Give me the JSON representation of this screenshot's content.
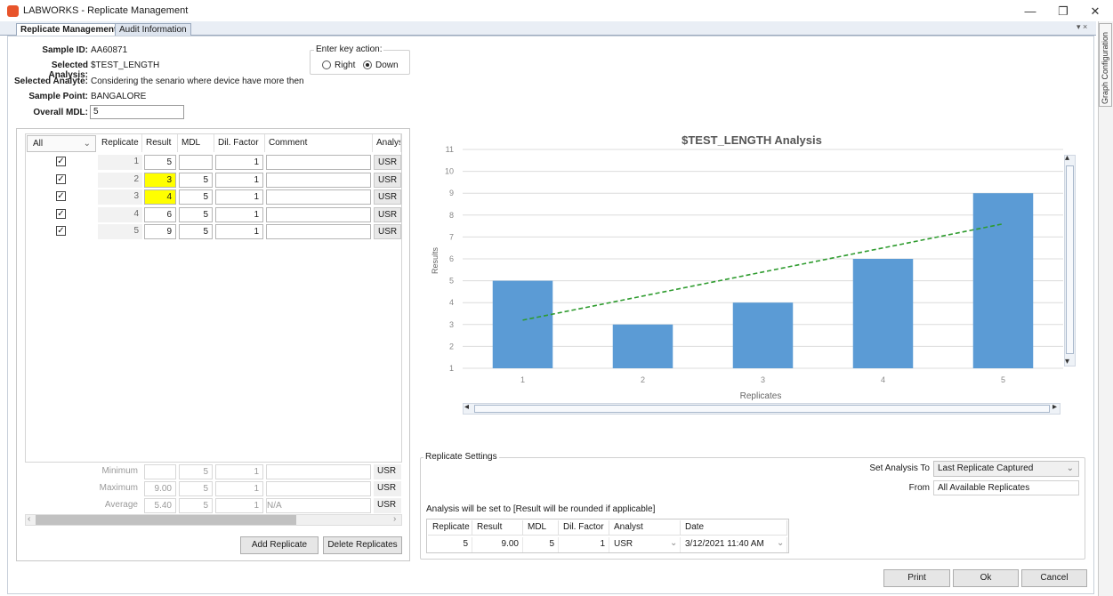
{
  "window": {
    "title": "LABWORKS - Replicate Management",
    "minimize": "—",
    "restore": "❐",
    "close": "✕"
  },
  "tabs": [
    {
      "label": "Replicate Management"
    },
    {
      "label": "Audit Information"
    }
  ],
  "tab_controls": {
    "pin": "▾ ×"
  },
  "side_panel": {
    "label": "Graph Configuration"
  },
  "sample": {
    "sample_id_label": "Sample ID:",
    "sample_id": "AA60871",
    "analysis_label": "Selected Analysis:",
    "analysis": "$TEST_LENGTH",
    "analyte_label": "Selected Analyte:",
    "analyte": "Considering the senario where device have more then",
    "point_label": "Sample Point:",
    "point": "BANGALORE",
    "mdl_label": "Overall MDL:",
    "mdl": "5"
  },
  "enter_key": {
    "title": "Enter key action:",
    "right": "Right",
    "down": "Down",
    "selected": "Down"
  },
  "grid": {
    "filter": "All",
    "columns": [
      "Replicate",
      "Result",
      "MDL",
      "Dil. Factor",
      "Comment",
      "Analys"
    ],
    "rows": [
      {
        "replicate": "1",
        "result": "5",
        "mdl": "",
        "dil": "1",
        "comment": "",
        "analyst": "USR",
        "highlight": false
      },
      {
        "replicate": "2",
        "result": "3",
        "mdl": "5",
        "dil": "1",
        "comment": "",
        "analyst": "USR",
        "highlight": true
      },
      {
        "replicate": "3",
        "result": "4",
        "mdl": "5",
        "dil": "1",
        "comment": "",
        "analyst": "USR",
        "highlight": true
      },
      {
        "replicate": "4",
        "result": "6",
        "mdl": "5",
        "dil": "1",
        "comment": "",
        "analyst": "USR",
        "highlight": false
      },
      {
        "replicate": "5",
        "result": "9",
        "mdl": "5",
        "dil": "1",
        "comment": "",
        "analyst": "USR",
        "highlight": false
      }
    ],
    "summary": [
      {
        "label": "Minimum",
        "result": "",
        "mdl": "5",
        "dil": "1",
        "comment": "",
        "analyst": "USR"
      },
      {
        "label": "Maximum",
        "result": "9.00",
        "mdl": "5",
        "dil": "1",
        "comment": "",
        "analyst": "USR"
      },
      {
        "label": "Average",
        "result": "5.40",
        "mdl": "5",
        "dil": "1",
        "comment": "N/A",
        "analyst": "USR"
      }
    ],
    "check_mark": "✓",
    "add_button": "Add Replicate",
    "delete_button": "Delete Replicates"
  },
  "chart_data": {
    "type": "bar",
    "title": "$TEST_LENGTH Analysis",
    "xlabel": "Replicates",
    "ylabel": "Results",
    "categories": [
      "1",
      "2",
      "3",
      "4",
      "5"
    ],
    "values": [
      5,
      3,
      4,
      6,
      9
    ],
    "ylim": [
      1,
      11
    ],
    "yticks": [
      "1",
      "2",
      "3",
      "4",
      "5",
      "6",
      "7",
      "8",
      "9",
      "10",
      "11"
    ],
    "trendline": {
      "start": [
        1,
        3.2
      ],
      "end": [
        5,
        7.6
      ],
      "color": "#2e9b2e",
      "style": "dashed"
    },
    "bar_color": "#5b9bd5",
    "grid": true
  },
  "settings": {
    "title": "Replicate Settings",
    "set_to_label": "Set Analysis To",
    "set_to_value": "Last Replicate Captured",
    "from_label": "From",
    "from_value": "All Available Replicates",
    "note": "Analysis will be set to [Result will be rounded if applicable]",
    "columns": [
      "Replicate",
      "Result",
      "MDL",
      "Dil. Factor",
      "Analyst",
      "Date"
    ],
    "row": {
      "replicate": "5",
      "result": "9.00",
      "mdl": "5",
      "dil": "1",
      "analyst": "USR",
      "date": "3/12/2021 11:40 AM"
    }
  },
  "footer": {
    "print": "Print",
    "ok": "Ok",
    "cancel": "Cancel"
  },
  "glyphs": {
    "chev": "⌄",
    "larrow": "◂",
    "rarrow": "▸",
    "uarrow": "▴",
    "darrow": "▾",
    "lchev": "‹",
    "rchev": "›"
  }
}
